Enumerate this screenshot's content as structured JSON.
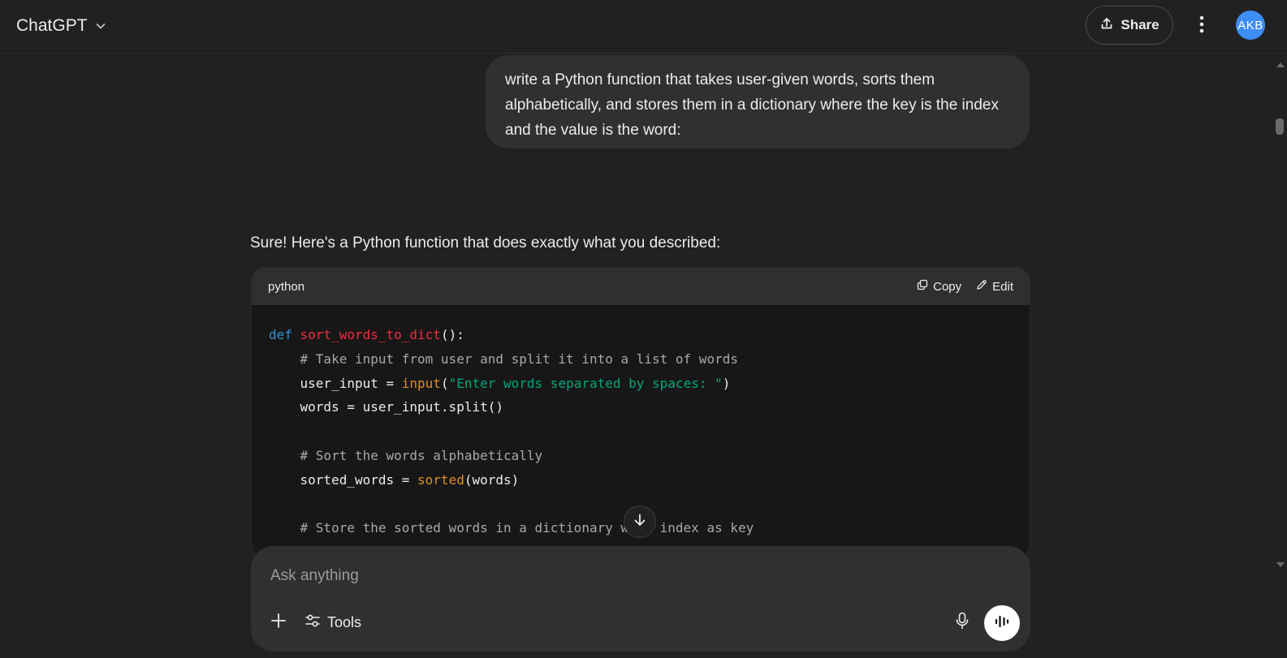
{
  "header": {
    "model_name": "ChatGPT",
    "share_label": "Share",
    "avatar_initials": "AKB",
    "avatar_color": "#3d8ef7"
  },
  "conversation": {
    "user_message": "write a Python function that takes user-given words, sorts them alphabetically, and stores them in a dictionary where the key is the index and the value is the word:",
    "assistant_intro": "Sure! Here's a Python function that does exactly what you described:",
    "code_block": {
      "language": "python",
      "copy_label": "Copy",
      "edit_label": "Edit",
      "lines": [
        [
          {
            "t": "def",
            "c": "kw"
          },
          {
            "t": " ",
            "c": ""
          },
          {
            "t": "sort_words_to_dict",
            "c": "fn"
          },
          {
            "t": "():",
            "c": ""
          }
        ],
        [
          {
            "t": "    # Take input from user and split it into a list of words",
            "c": "cm"
          }
        ],
        [
          {
            "t": "    user_input = ",
            "c": ""
          },
          {
            "t": "input",
            "c": "bi"
          },
          {
            "t": "(",
            "c": ""
          },
          {
            "t": "\"Enter words separated by spaces: \"",
            "c": "st"
          },
          {
            "t": ")",
            "c": ""
          }
        ],
        [
          {
            "t": "    words = user_input.split()",
            "c": ""
          }
        ],
        [],
        [
          {
            "t": "    # Sort the words alphabetically",
            "c": "cm"
          }
        ],
        [
          {
            "t": "    sorted_words = ",
            "c": ""
          },
          {
            "t": "sorted",
            "c": "bi"
          },
          {
            "t": "(words)",
            "c": ""
          }
        ],
        [],
        [
          {
            "t": "    # Store the sorted words in a dictionary with index as key",
            "c": "cm"
          }
        ]
      ]
    }
  },
  "composer": {
    "placeholder": "Ask anything",
    "tools_label": "Tools"
  },
  "icons": [
    "chevron-down-icon",
    "share-icon",
    "more-vertical-icon",
    "copy-icon",
    "edit-icon",
    "arrow-down-icon",
    "plus-icon",
    "tools-sliders-icon",
    "microphone-icon",
    "voice-wave-icon"
  ]
}
